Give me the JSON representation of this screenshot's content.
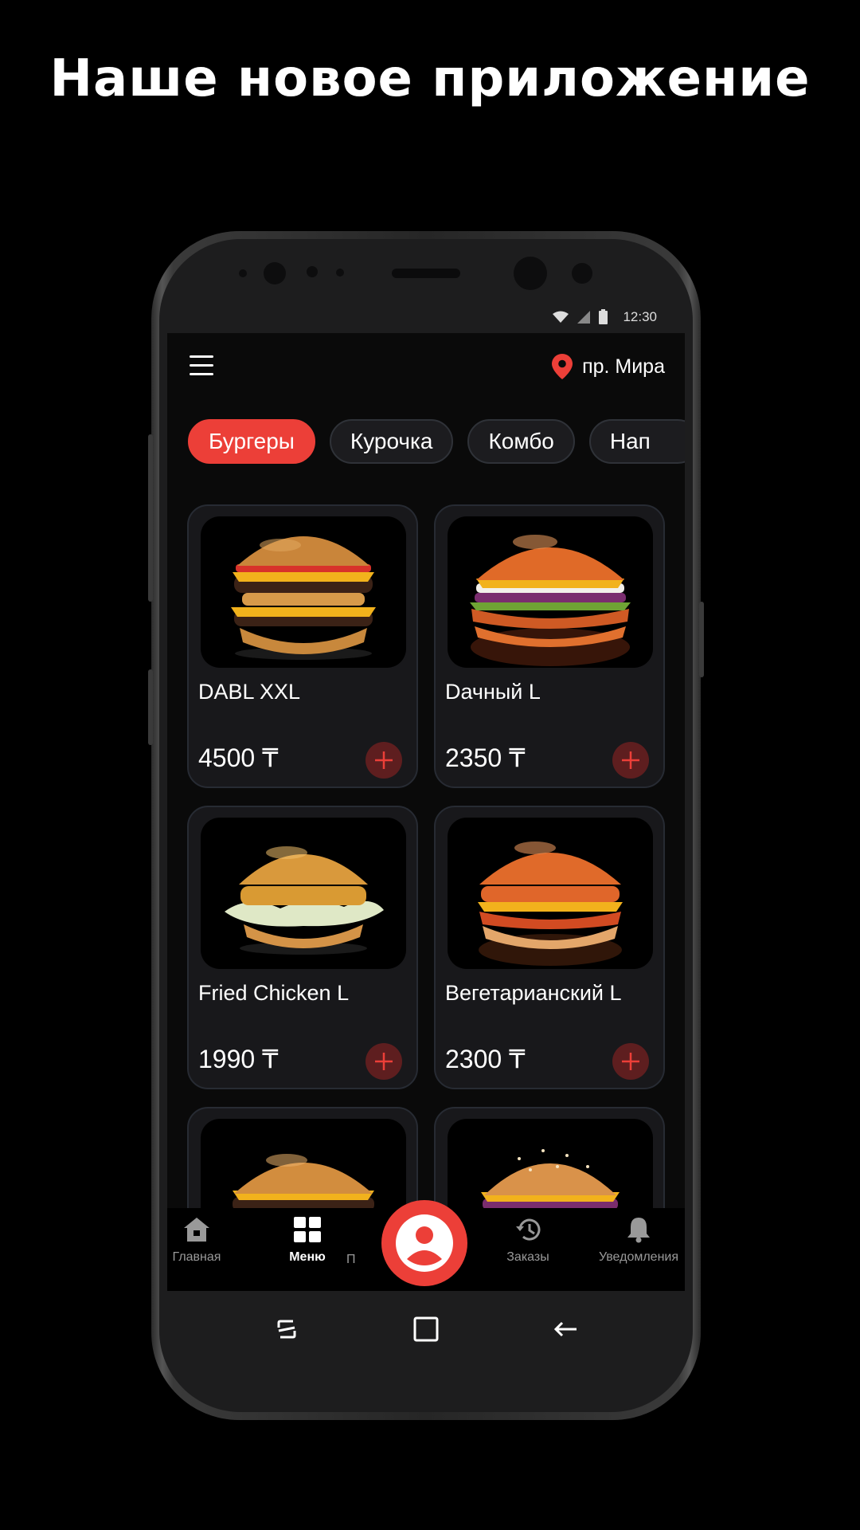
{
  "headline": "Наше новое приложение",
  "status": {
    "time": "12:30"
  },
  "header": {
    "location": "пр. Мира"
  },
  "categories": [
    {
      "label": "Бургеры",
      "active": true
    },
    {
      "label": "Курочка",
      "active": false
    },
    {
      "label": "Комбо",
      "active": false
    },
    {
      "label": "Нап",
      "active": false
    }
  ],
  "products": [
    {
      "name": "DABL XXL",
      "price": "4500 ₸"
    },
    {
      "name": "Dачный L",
      "price": "2350 ₸"
    },
    {
      "name": "Fried Chicken L",
      "price": "1990 ₸"
    },
    {
      "name": "Вегетарианский L",
      "price": "2300 ₸"
    }
  ],
  "bottom_nav": {
    "home": "Главная",
    "menu": "Меню",
    "profile": "П",
    "orders": "Заказы",
    "notifications": "Уведомления"
  },
  "colors": {
    "accent": "#ec3f38",
    "background": "#0a0a0a",
    "card": "#18181b"
  }
}
